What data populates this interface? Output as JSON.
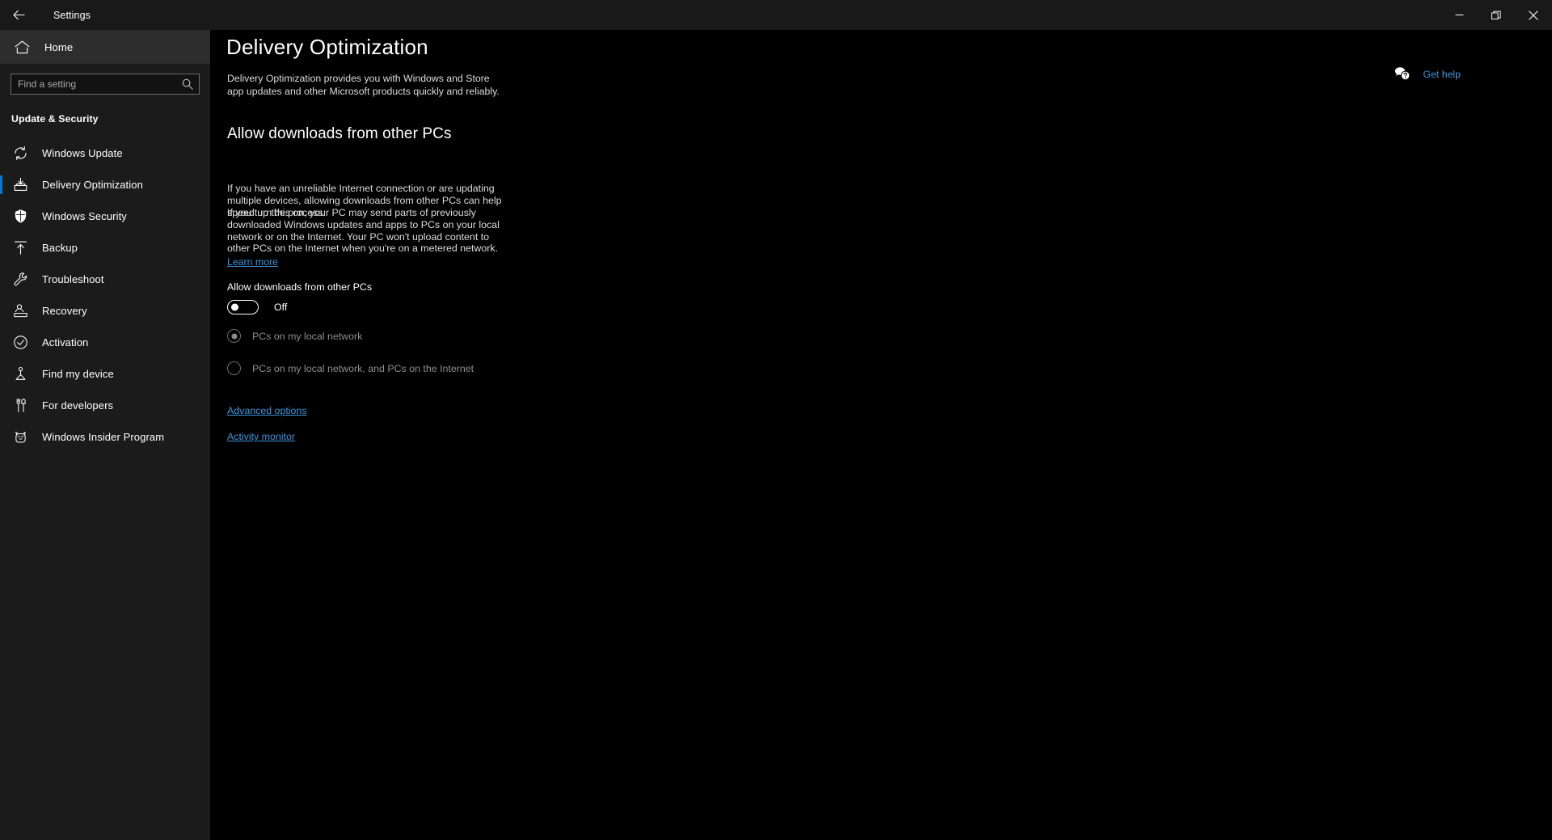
{
  "titlebar": {
    "back_label": "Back",
    "app_title": "Settings",
    "minimize_label": "Minimize",
    "restore_label": "Restore",
    "close_label": "Close"
  },
  "sidebar": {
    "home_label": "Home",
    "search": {
      "placeholder": "Find a setting",
      "value": ""
    },
    "group_title": "Update & Security",
    "items": [
      {
        "label": "Windows Update",
        "icon": "sync-icon",
        "selected": false
      },
      {
        "label": "Delivery Optimization",
        "icon": "delivery-icon",
        "selected": true
      },
      {
        "label": "Windows Security",
        "icon": "shield-icon",
        "selected": false
      },
      {
        "label": "Backup",
        "icon": "upload-arrow-icon",
        "selected": false
      },
      {
        "label": "Troubleshoot",
        "icon": "wrench-icon",
        "selected": false
      },
      {
        "label": "Recovery",
        "icon": "recovery-icon",
        "selected": false
      },
      {
        "label": "Activation",
        "icon": "check-circle-icon",
        "selected": false
      },
      {
        "label": "Find my device",
        "icon": "person-pin-icon",
        "selected": false
      },
      {
        "label": "For developers",
        "icon": "tools-icon",
        "selected": false
      },
      {
        "label": "Windows Insider Program",
        "icon": "ninjacat-icon",
        "selected": false
      }
    ],
    "accent_color": "#0078d7"
  },
  "main": {
    "page_title": "Delivery Optimization",
    "page_description": "Delivery Optimization provides you with Windows and Store app updates and other Microsoft products quickly and reliably.",
    "get_help": {
      "label": "Get help",
      "icon": "help-chat-icon",
      "color": "#3b96dd"
    },
    "section": {
      "title": "Allow downloads from other PCs",
      "paragraph_1": "If you have an unreliable Internet connection or are updating multiple devices, allowing downloads from other PCs can help speed up the process.",
      "paragraph_2": "If you turn this on, your PC may send parts of previously downloaded Windows updates and apps to PCs on your local network or on the Internet. Your PC won't upload content to other PCs on the Internet when you're on a metered network.",
      "learn_more_label": "Learn more"
    },
    "toggle": {
      "label": "Allow downloads from other PCs",
      "state_label": "Off",
      "checked": false
    },
    "radios": [
      {
        "label": "PCs on my local network",
        "checked": true,
        "disabled": true
      },
      {
        "label": "PCs on my local network, and PCs on the Internet",
        "checked": false,
        "disabled": true
      }
    ],
    "links": {
      "advanced_options": "Advanced options",
      "activity_monitor": "Activity monitor"
    }
  }
}
